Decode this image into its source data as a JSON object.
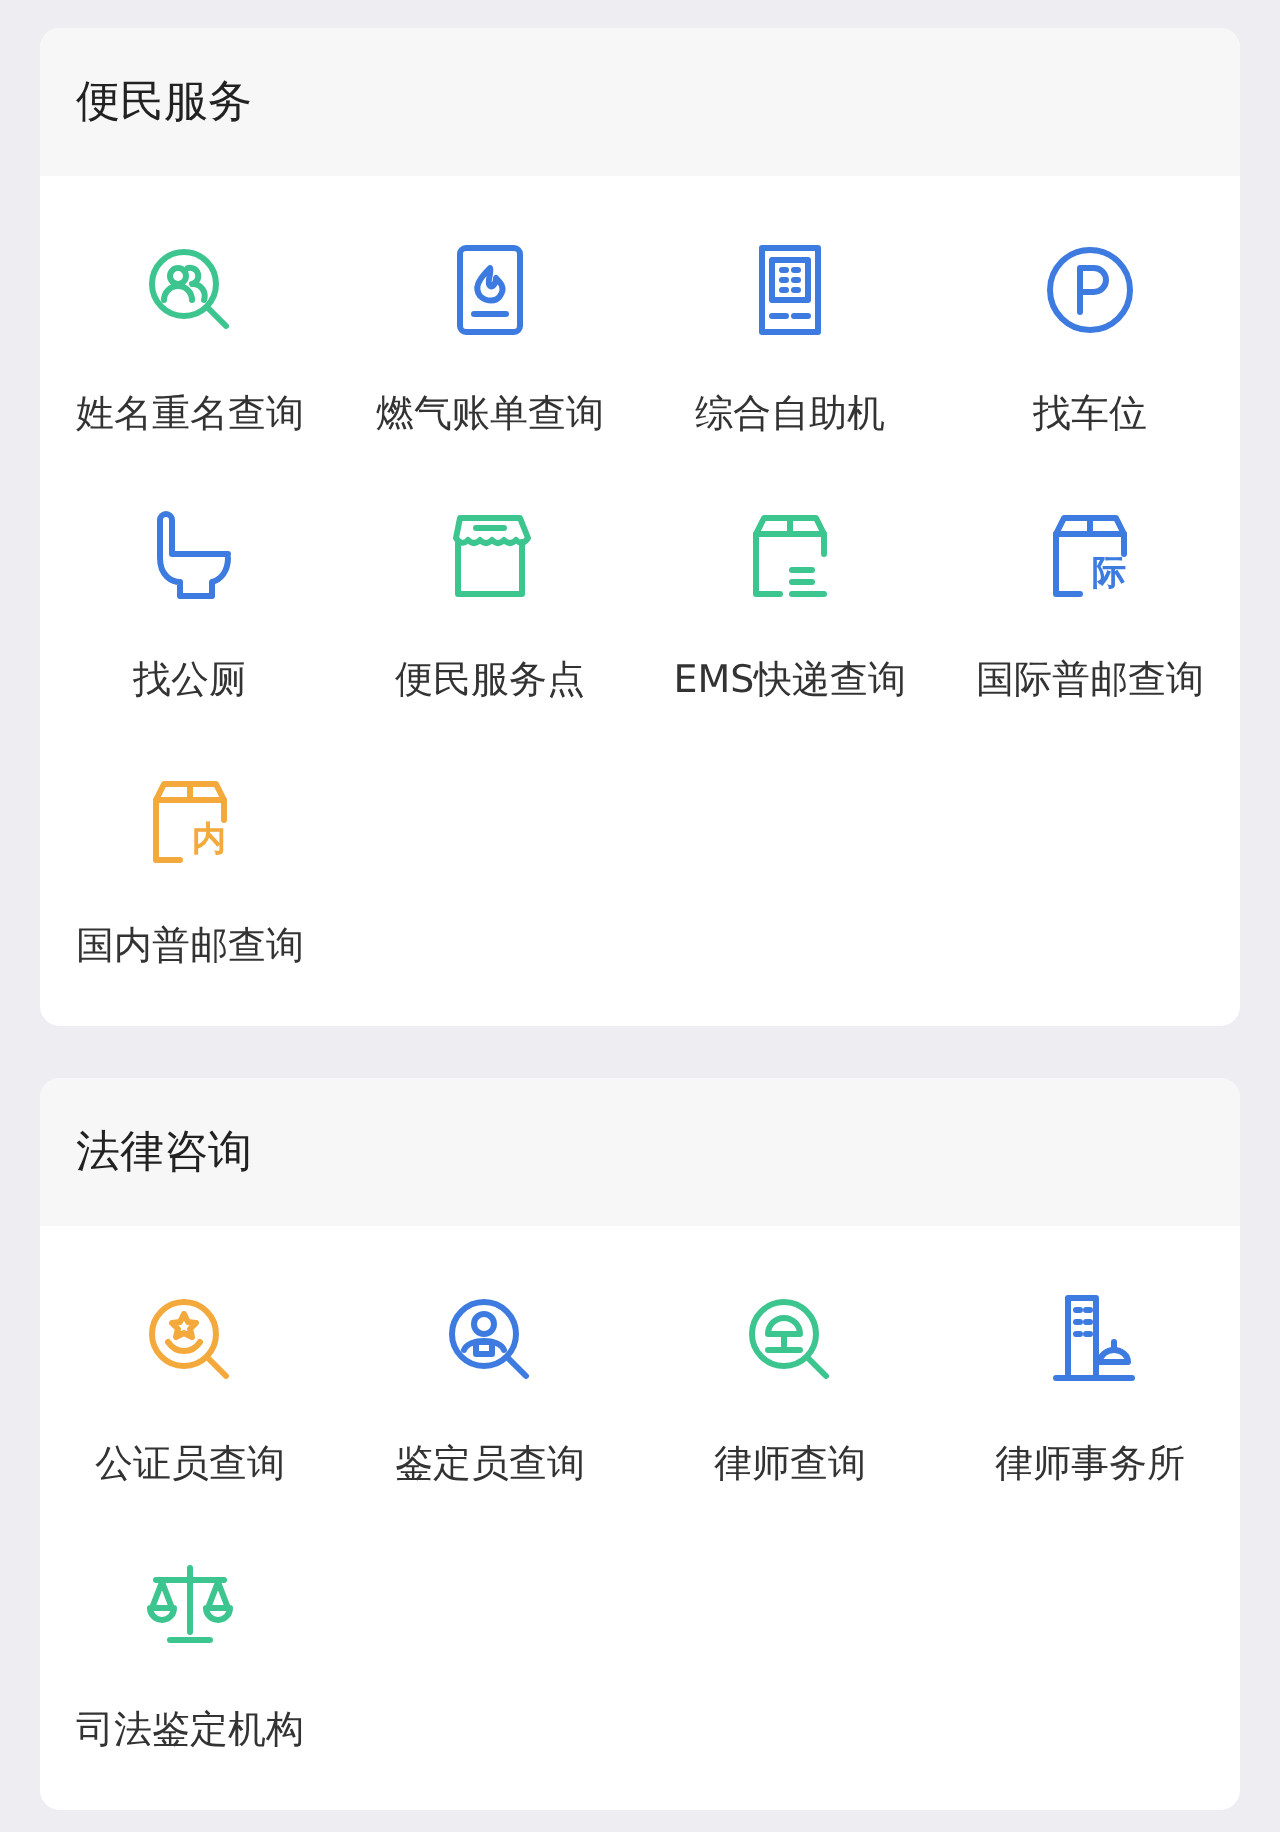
{
  "sections": [
    {
      "title": "便民服务",
      "items": [
        {
          "label": "姓名重名查询",
          "kind": "people-search",
          "color": "#3dc58f"
        },
        {
          "label": "燃气账单查询",
          "kind": "gas",
          "color": "#3d7be0"
        },
        {
          "label": "综合自助机",
          "kind": "kiosk",
          "color": "#3d7be0"
        },
        {
          "label": "找车位",
          "kind": "parking",
          "color": "#3d7be0"
        },
        {
          "label": "找公厕",
          "kind": "toilet",
          "color": "#3d7be0"
        },
        {
          "label": "便民服务点",
          "kind": "store",
          "color": "#3dc58f"
        },
        {
          "label": "EMS快递查询",
          "kind": "parcel",
          "color": "#3dc58f"
        },
        {
          "label": "国际普邮查询",
          "kind": "parcel-badge",
          "badge": "际",
          "color": "#3d7be0"
        },
        {
          "label": "国内普邮查询",
          "kind": "parcel-badge",
          "badge": "内",
          "color": "#f3a93c"
        }
      ]
    },
    {
      "title": "法律咨询",
      "items": [
        {
          "label": "公证员查询",
          "kind": "star-search",
          "color": "#f3a93c"
        },
        {
          "label": "鉴定员查询",
          "kind": "person-search",
          "color": "#3d7be0"
        },
        {
          "label": "律师查询",
          "kind": "scale-search",
          "color": "#3dc58f"
        },
        {
          "label": "律师事务所",
          "kind": "building",
          "color": "#3d7be0"
        },
        {
          "label": "司法鉴定机构",
          "kind": "balance",
          "color": "#3dc58f"
        }
      ]
    }
  ]
}
